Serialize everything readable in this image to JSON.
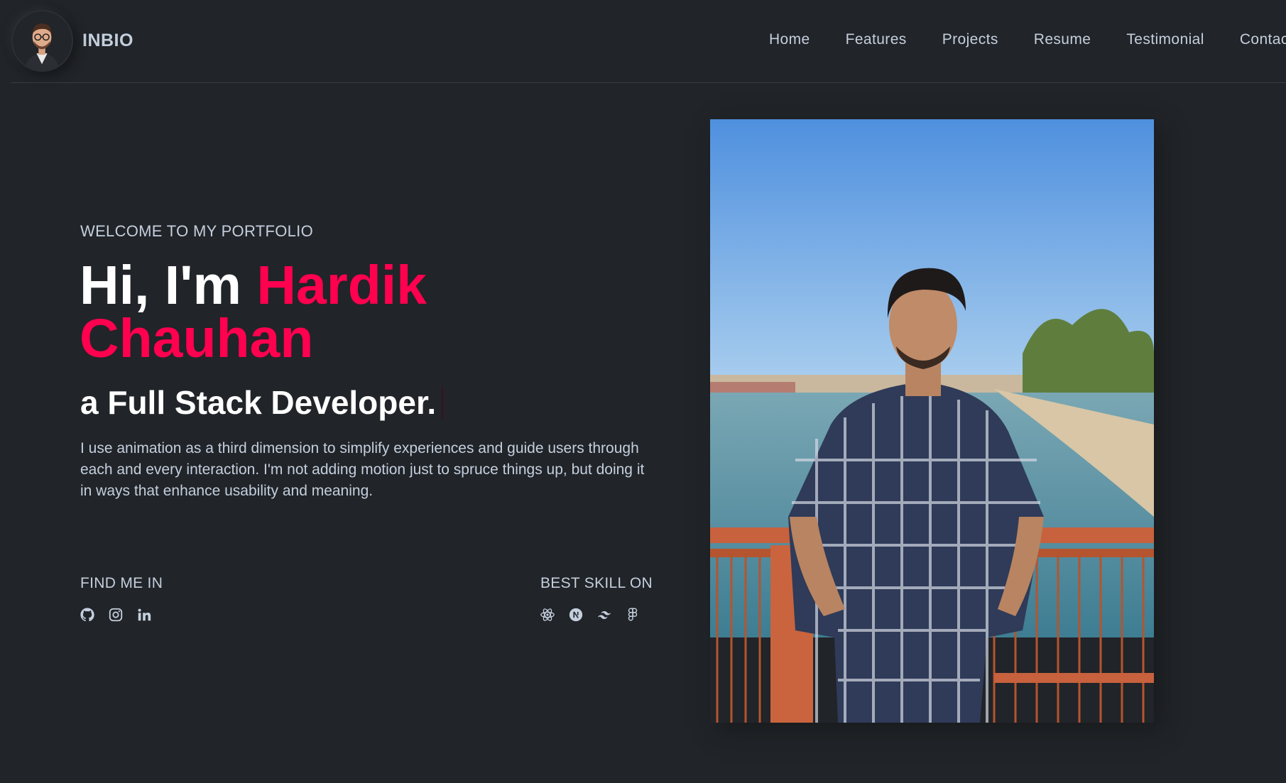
{
  "header": {
    "brand": "INBIO",
    "nav": [
      "Home",
      "Features",
      "Projects",
      "Resume",
      "Testimonial",
      "Contact"
    ]
  },
  "hero": {
    "welcome": "WELCOME TO MY PORTFOLIO",
    "greeting": "Hi, I'm ",
    "name": "Hardik Chauhan",
    "role": "a Full Stack Developer.",
    "description": "I use animation as a third dimension to simplify experiences and guide users through each and every interaction. I'm not adding motion just to spruce things up, but doing it in ways that enhance usability and meaning."
  },
  "find_me": {
    "label": "FIND ME IN",
    "icons": [
      "github-icon",
      "instagram-icon",
      "linkedin-icon"
    ]
  },
  "skills": {
    "label": "BEST SKILL ON",
    "icons": [
      "react-icon",
      "nextjs-icon",
      "tailwind-icon",
      "figma-icon"
    ]
  },
  "colors": {
    "background": "#212428",
    "accent": "#ff014f",
    "text": "#c4cfde",
    "heading": "#ffffff"
  }
}
